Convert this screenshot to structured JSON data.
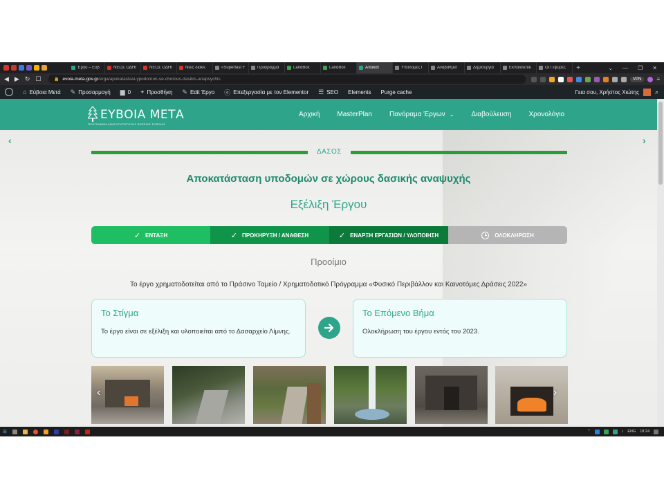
{
  "browser": {
    "tabs": [
      {
        "label": "Έργο – Εύβ",
        "color": "#2ea58a",
        "active": false
      },
      {
        "label": "ΝΕΟΣ ΟΔΗΓ",
        "color": "#d9342b",
        "active": false
      },
      {
        "label": "ΝΕΟΣ ΟΔΗΓ",
        "color": "#d9342b",
        "active": false
      },
      {
        "label": "Νέες διακλ.",
        "color": "#d9342b",
        "active": false
      },
      {
        "label": "«Superfast F",
        "color": "#888888",
        "active": false
      },
      {
        "label": "Πρόγραμμα",
        "color": "#888888",
        "active": false
      },
      {
        "label": "LandBox",
        "color": "#3fa34d",
        "active": false
      },
      {
        "label": "LandBox",
        "color": "#3fa34d",
        "active": false
      },
      {
        "label": "Αποκατ",
        "color": "#2ea58a",
        "active": true
      },
      {
        "label": "Υποδομές Γ",
        "color": "#888888",
        "active": false
      },
      {
        "label": "Αναβάθμισ",
        "color": "#888888",
        "active": false
      },
      {
        "label": "Δημιουργία",
        "color": "#888888",
        "active": false
      },
      {
        "label": "Εκπαιδευτικ",
        "color": "#888888",
        "active": false
      },
      {
        "label": "Οι Γέφυρες",
        "color": "#888888",
        "active": false
      }
    ],
    "url_domain": "evoia-meta.gov.gr",
    "url_path": "/erga/apokatastasi-ypodomon-se-chorous-dasikis-anapsychis",
    "vpn_label": "VPN"
  },
  "wpbar": {
    "site": "Εύβοια Μετά",
    "customize": "Προσαρμογή",
    "comments": "0",
    "new": "Προσθήκη",
    "edit": "Edit Έργο",
    "elementor": "Επεξεργασία με τον Elementor",
    "seo": "SEO",
    "elements": "Elements",
    "purge": "Purge cache",
    "greeting": "Γεια σου, Χρήστος Χιώτης"
  },
  "site": {
    "logo_name": "ΕΥΒΟΙΑ ΜΕΤΑ",
    "logo_tag": "ΠΡΟΓΡΑΜΜΑ ΑΝΑΣΥΓΚΡΟΤΗΣΗΣ ΒΟΡΕΙΑΣ ΕΥΒΟΙΑΣ",
    "nav": [
      "Αρχική",
      "MasterPlan",
      "Πανόραμα Έργων",
      "Διαβούλευση",
      "Χρονολόγιο"
    ]
  },
  "project": {
    "category": "ΔΑΣΟΣ",
    "title": "Αποκατάσταση υποδομών σε χώρους δασικής αναψυχής",
    "subtitle": "Εξέλιξη Έργου",
    "steps": [
      {
        "label": "ΕΝΤΑΞΗ",
        "status": "done",
        "color": "#1fbe62"
      },
      {
        "label": "ΠΡΟΚΗΡΥΞΗ / ΑΝΑΘΕΣΗ",
        "status": "done",
        "color": "#10944a"
      },
      {
        "label": "ΕΝΑΡΞΗ ΕΡΓΑΣΙΩΝ / ΥΛΟΠΟΙΗΣΗ",
        "status": "done",
        "color": "#0b7a3b"
      },
      {
        "label": "ΟΛΟΚΛΗΡΩΣΗ",
        "status": "pending",
        "color": "#b5b5b5"
      }
    ],
    "intro_heading": "Προοίμιο",
    "funding": "Το έργο χρηματοδοτείται από το Πράσινο Ταμείο / Χρηματοδοτικό Πρόγραμμα «Φυσικό Περιβάλλον και Καινοτόμες Δράσεις 2022»",
    "status_card": {
      "title": "Το Στίγμα",
      "text": "Το έργο είναι σε εξέλιξη και υλοποιείται από το Δασαρχείο Λίμνης."
    },
    "next_card": {
      "title": "Το Επόμενο Βήμα",
      "text": "Ολοκλήρωση του έργου εντός του 2023."
    }
  },
  "taskbar": {
    "lang": "ENG",
    "time": "18:24"
  }
}
